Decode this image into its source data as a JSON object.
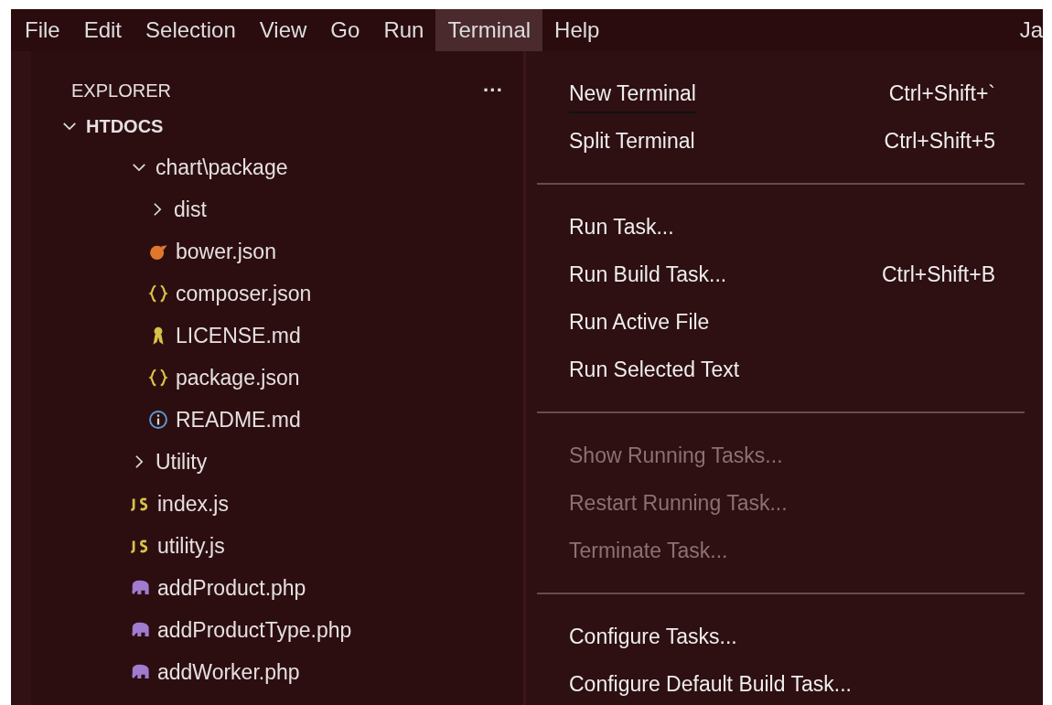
{
  "menubar": {
    "items": [
      {
        "label": "File",
        "selected": false
      },
      {
        "label": "Edit",
        "selected": false
      },
      {
        "label": "Selection",
        "selected": false
      },
      {
        "label": "View",
        "selected": false
      },
      {
        "label": "Go",
        "selected": false
      },
      {
        "label": "Run",
        "selected": false
      },
      {
        "label": "Terminal",
        "selected": true
      },
      {
        "label": "Help",
        "selected": false
      }
    ],
    "title": "Ja"
  },
  "explorer": {
    "title": "EXPLORER",
    "more": "···",
    "tree": [
      {
        "label": "HTDOCS",
        "kind": "root",
        "expanded": true,
        "children": [
          {
            "label": "chart\\package",
            "kind": "folder",
            "expanded": true,
            "children": [
              {
                "label": "dist",
                "kind": "folder",
                "expanded": false
              },
              {
                "label": "bower.json",
                "kind": "bower"
              },
              {
                "label": "composer.json",
                "kind": "json"
              },
              {
                "label": "LICENSE.md",
                "kind": "license"
              },
              {
                "label": "package.json",
                "kind": "json"
              },
              {
                "label": "README.md",
                "kind": "info"
              }
            ]
          },
          {
            "label": "Utility",
            "kind": "folder",
            "expanded": false
          },
          {
            "label": "index.js",
            "kind": "js"
          },
          {
            "label": "utility.js",
            "kind": "js"
          },
          {
            "label": "addProduct.php",
            "kind": "php"
          },
          {
            "label": "addProductType.php",
            "kind": "php"
          },
          {
            "label": "addWorker.php",
            "kind": "php"
          }
        ]
      }
    ]
  },
  "terminal_menu": {
    "groups": [
      [
        {
          "label": "New Terminal",
          "shortcut": "Ctrl+Shift+`",
          "disabled": false,
          "underlined": true
        },
        {
          "label": "Split Terminal",
          "shortcut": "Ctrl+Shift+5",
          "disabled": false,
          "underlined": false
        }
      ],
      [
        {
          "label": "Run Task...",
          "disabled": false,
          "underlined": false
        },
        {
          "label": "Run Build Task...",
          "shortcut": "Ctrl+Shift+B",
          "disabled": false,
          "underlined": false
        },
        {
          "label": "Run Active File",
          "disabled": false,
          "underlined": false
        },
        {
          "label": "Run Selected Text",
          "disabled": false,
          "underlined": false
        }
      ],
      [
        {
          "label": "Show Running Tasks...",
          "disabled": true,
          "underlined": false
        },
        {
          "label": "Restart Running Task...",
          "disabled": true,
          "underlined": false
        },
        {
          "label": "Terminate Task...",
          "disabled": true,
          "underlined": false
        }
      ],
      [
        {
          "label": "Configure Tasks...",
          "disabled": false,
          "underlined": false
        },
        {
          "label": "Configure Default Build Task...",
          "disabled": false,
          "underlined": false
        }
      ]
    ]
  }
}
